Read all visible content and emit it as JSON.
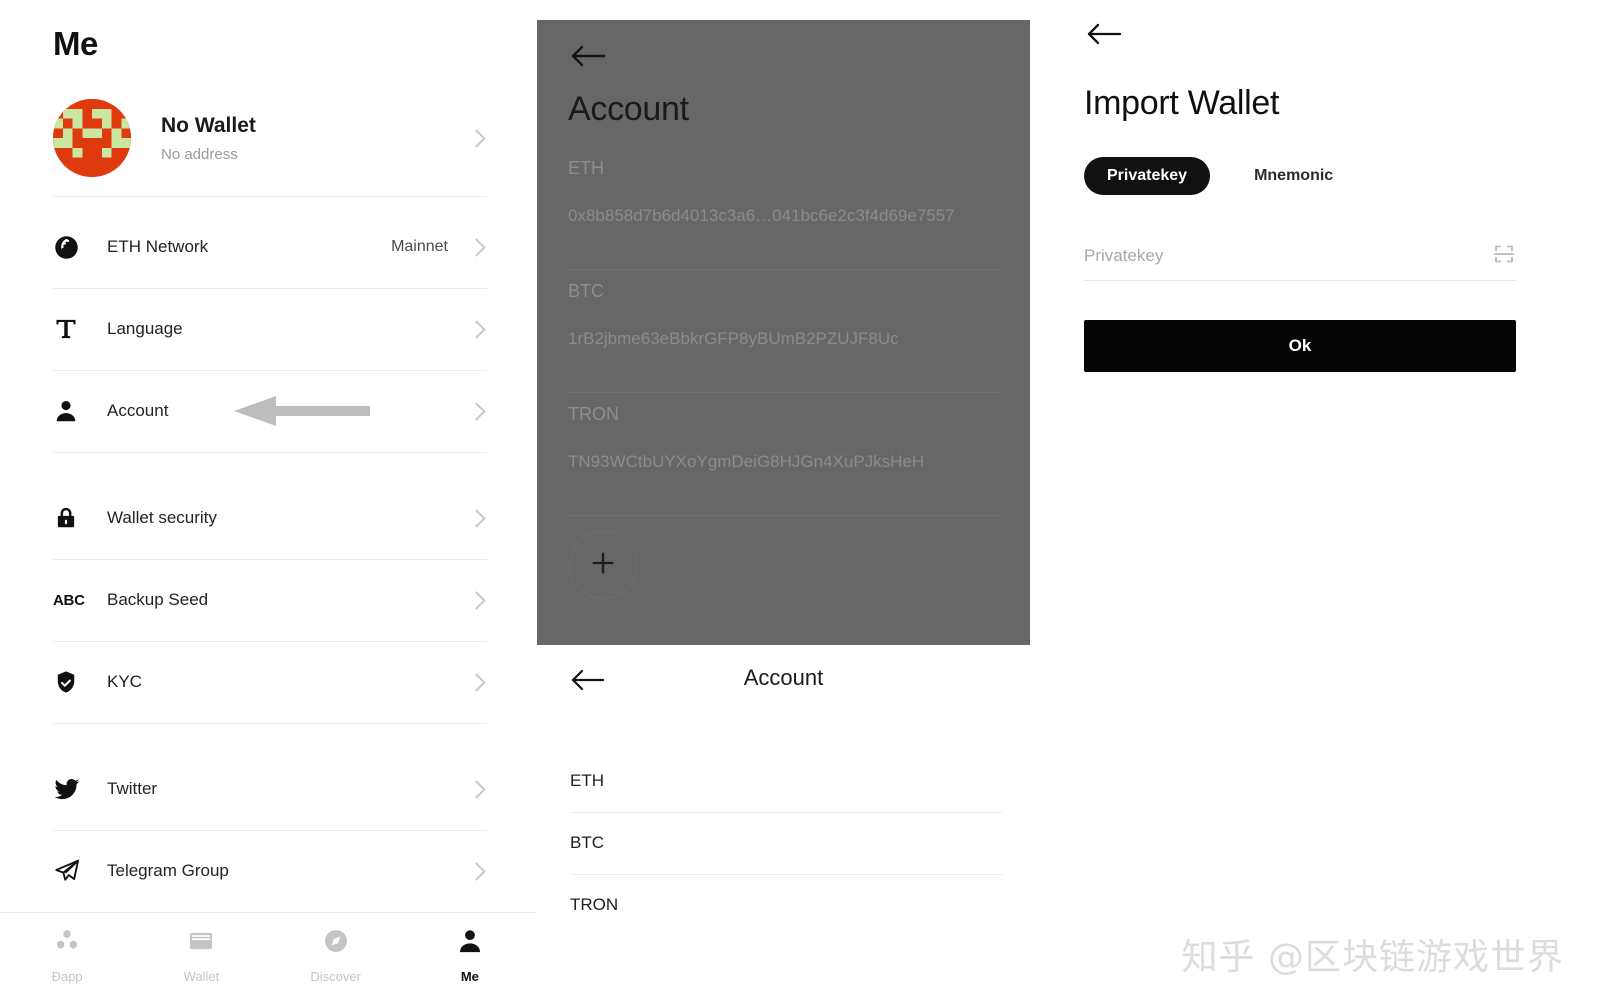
{
  "me_screen": {
    "title": "Me",
    "wallet": {
      "name": "No Wallet",
      "address": "No address",
      "avatar_colors": {
        "background": "#df3a0e",
        "blocks": "#cbe6a0"
      }
    },
    "settings": [
      {
        "icon": "globe-icon",
        "label": "ETH Network",
        "value": "Mainnet"
      },
      {
        "icon": "text-t-icon",
        "label": "Language",
        "value": ""
      },
      {
        "icon": "person-icon",
        "label": "Account",
        "value": ""
      },
      {
        "icon": "lock-icon",
        "label": "Wallet security",
        "value": ""
      },
      {
        "icon": "abc-icon",
        "label": "Backup Seed",
        "value": ""
      },
      {
        "icon": "shield-check-icon",
        "label": "KYC",
        "value": ""
      },
      {
        "icon": "twitter-icon",
        "label": "Twitter",
        "value": ""
      },
      {
        "icon": "telegram-icon",
        "label": "Telegram Group",
        "value": ""
      }
    ],
    "tabs": [
      {
        "icon": "dapp-icon",
        "label": "Ðapp",
        "active": false
      },
      {
        "icon": "wallet-icon",
        "label": "Wallet",
        "active": false
      },
      {
        "icon": "compass-icon",
        "label": "Discover",
        "active": false
      },
      {
        "icon": "person-icon",
        "label": "Me",
        "active": true
      }
    ]
  },
  "account_overlay": {
    "back_icon": "back-arrow-icon",
    "title": "Account",
    "add_icon": "plus-icon",
    "entries": [
      {
        "label": "ETH",
        "address": "0x8b858d7b6d4013c3a6…041bc6e2c3f4d69e7557"
      },
      {
        "label": "BTC",
        "address": "1rB2jbme63eBbkrGFP8yBUmB2PZUJF8Uc"
      },
      {
        "label": "TRON",
        "address": "TN93WCtbUYXoYgmDeiG8HJGn4XuPJksHeH"
      }
    ]
  },
  "account_list": {
    "back_icon": "back-arrow-icon",
    "title": "Account",
    "rows": [
      {
        "label": "ETH"
      },
      {
        "label": "BTC"
      },
      {
        "label": "TRON"
      }
    ]
  },
  "import_wallet": {
    "back_icon": "back-arrow-icon",
    "title": "Import Wallet",
    "tabs": [
      {
        "label": "Privatekey",
        "active": true
      },
      {
        "label": "Mnemonic",
        "active": false
      }
    ],
    "input": {
      "value": "",
      "placeholder": "Privatekey",
      "scan_icon": "qr-scan-icon"
    },
    "submit_label": "Ok",
    "accent_color": "#050505"
  },
  "annotation": {
    "arrow": "left-pointing-arrow",
    "color": "#bdbdbd"
  },
  "watermark": {
    "text": "知乎 @区块链游戏世界"
  }
}
